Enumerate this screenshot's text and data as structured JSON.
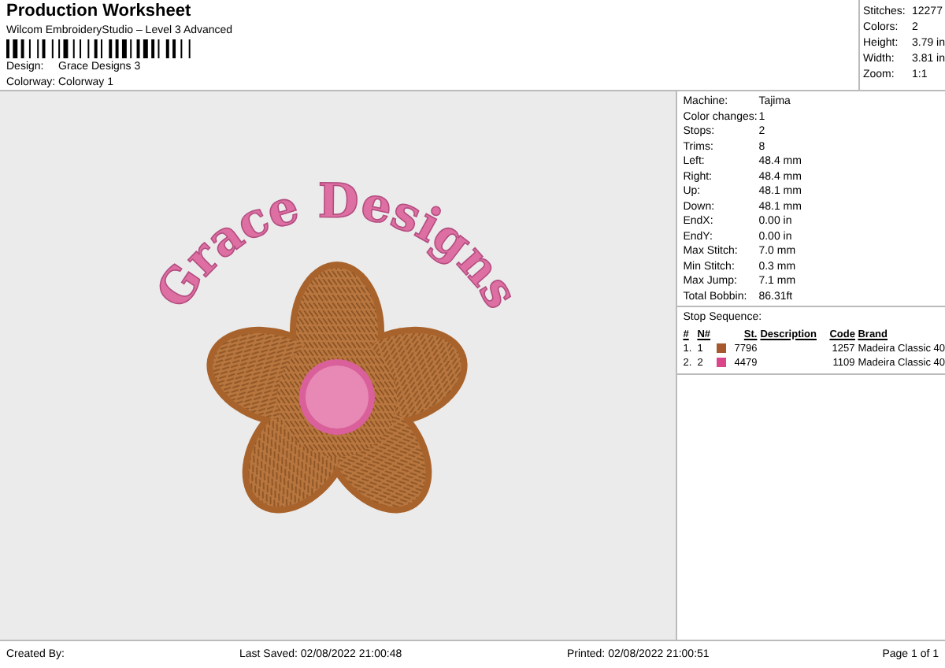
{
  "title": "Production Worksheet",
  "subtitle": "Wilcom EmbroideryStudio – Level 3 Advanced",
  "fields": [
    {
      "label": "Design:",
      "value": "Grace Designs 3"
    },
    {
      "label": "Colorway:",
      "value": "Colorway 1"
    }
  ],
  "summary": [
    {
      "label": "Stitches:",
      "value": "12277"
    },
    {
      "label": "Colors:",
      "value": "2"
    },
    {
      "label": "Height:",
      "value": "3.79 in"
    },
    {
      "label": "Width:",
      "value": "3.81 in"
    },
    {
      "label": "Zoom:",
      "value": "1:1"
    }
  ],
  "design_preview": {
    "text": "Grace Designs"
  },
  "machine_info": [
    {
      "label": "Machine:",
      "value": "Tajima"
    },
    {
      "label": "Color changes:",
      "value": "1"
    },
    {
      "label": "Stops:",
      "value": "2"
    },
    {
      "label": "Trims:",
      "value": "8"
    },
    {
      "label": "Left:",
      "value": "48.4 mm"
    },
    {
      "label": "Right:",
      "value": "48.4 mm"
    },
    {
      "label": "Up:",
      "value": "48.1 mm"
    },
    {
      "label": "Down:",
      "value": "48.1 mm"
    },
    {
      "label": "EndX:",
      "value": "0.00 in"
    },
    {
      "label": "EndY:",
      "value": "0.00 in"
    },
    {
      "label": "Max Stitch:",
      "value": "7.0 mm"
    },
    {
      "label": "Min Stitch:",
      "value": "0.3 mm"
    },
    {
      "label": "Max Jump:",
      "value": "7.1 mm"
    },
    {
      "label": "Total Bobbin:",
      "value": "86.31ft"
    }
  ],
  "stop_sequence": {
    "title": "Stop Sequence:",
    "columns": [
      "#",
      "N#",
      "St.",
      "Description",
      "Code",
      "Brand"
    ],
    "rows": [
      {
        "index": "1.",
        "needle": "1",
        "color": "#a5592c",
        "stitches": "7796",
        "code": "1257",
        "brand": "Madeira Classic 40"
      },
      {
        "index": "2.",
        "needle": "2",
        "color": "#d9478a",
        "stitches": "4479",
        "code": "1109",
        "brand": "Madeira Classic 40"
      }
    ]
  },
  "footer": {
    "created_by": "Created By:",
    "last_saved": "Last Saved: 02/08/2022 21:00:48",
    "printed": "Printed: 02/08/2022 21:00:51",
    "page": "Page 1 of 1"
  }
}
